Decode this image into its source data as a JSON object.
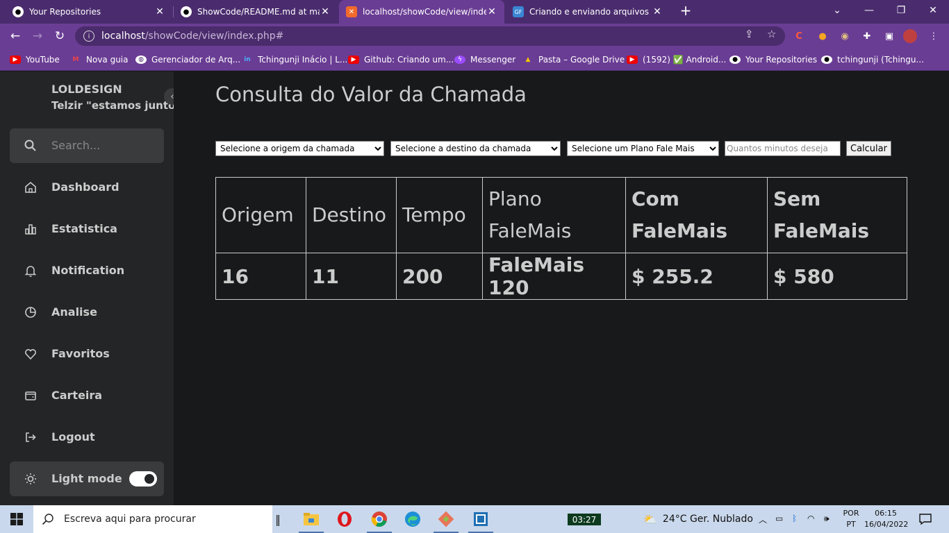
{
  "browser": {
    "tabs": [
      {
        "title": "Your Repositories",
        "icon": "github-icon",
        "active": false
      },
      {
        "title": "ShowCode/README.md at main",
        "icon": "github-icon",
        "active": false
      },
      {
        "title": "localhost/showCode/view/index.php#",
        "icon": "xampp-icon",
        "active": true
      },
      {
        "title": "Criando e enviando arquivos para",
        "icon": "gf-icon",
        "active": false
      }
    ],
    "new_tab": "+",
    "url_host": "localhost",
    "url_path": "/showCode/view/index.php#",
    "bookmarks": [
      {
        "label": "YouTube",
        "icon": "youtube-icon"
      },
      {
        "label": "Nova guia",
        "icon": "gmail-icon"
      },
      {
        "label": "Gerenciador de Arq...",
        "icon": "globe-icon"
      },
      {
        "label": "Tchingunji Inácio | L...",
        "icon": "linkedin-icon"
      },
      {
        "label": "Github: Criando um...",
        "icon": "youtube-icon"
      },
      {
        "label": "Messenger",
        "icon": "messenger-icon"
      },
      {
        "label": "Pasta – Google Drive",
        "icon": "drive-icon"
      },
      {
        "label": "(1592) ✅ Android...",
        "icon": "youtube-icon"
      },
      {
        "label": "Your Repositories",
        "icon": "github-icon"
      },
      {
        "label": "tchingunji (Tchingu...",
        "icon": "github-icon"
      }
    ]
  },
  "sidebar": {
    "brand": "LOLDESIGN",
    "subtitle": "Telzir \"estamos juntos",
    "search_placeholder": "Search...",
    "items": [
      {
        "label": "Dashboard",
        "icon": "home-icon"
      },
      {
        "label": "Estatistica",
        "icon": "bar-chart-icon"
      },
      {
        "label": "Notification",
        "icon": "bell-icon"
      },
      {
        "label": "Analise",
        "icon": "pie-chart-icon"
      },
      {
        "label": "Favoritos",
        "icon": "heart-icon"
      },
      {
        "label": "Carteira",
        "icon": "wallet-icon"
      },
      {
        "label": "Logout",
        "icon": "logout-icon"
      }
    ],
    "light_mode_label": "Light mode"
  },
  "main": {
    "title": "Consulta do Valor da Chamada",
    "form": {
      "origin_select": "Selecione a origem da chamada",
      "destination_select": "Selecione a destino da chamada",
      "plan_select": "Selecione um Plano Fale Mais",
      "minutes_placeholder": "Quantos minutos deseja",
      "calculate_button": "Calcular"
    },
    "table": {
      "headers": [
        "Origem",
        "Destino",
        "Tempo",
        "Plano FaleMais",
        "Com FaleMais",
        "Sem FaleMais"
      ],
      "rows": [
        [
          "16",
          "11",
          "200",
          "FaleMais 120",
          "$ 255.2",
          "$ 580"
        ]
      ]
    }
  },
  "taskbar": {
    "search_placeholder": "Escreva aqui para procurar",
    "timer": "03:27",
    "weather": "24°C  Ger. Nublado",
    "lang_1": "POR",
    "lang_2": "PT",
    "time": "06:15",
    "date": "16/04/2022"
  }
}
